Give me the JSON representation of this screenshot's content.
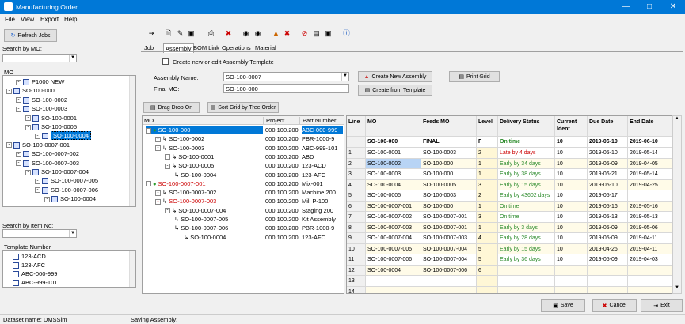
{
  "window": {
    "title": "Manufacturing Order"
  },
  "menu": [
    "File",
    "View",
    "Export",
    "Help"
  ],
  "left": {
    "refresh_label": "Refresh Jobs",
    "search_mo_label": "Search by MO:",
    "mo_header": "MO",
    "mo_tree": [
      {
        "label": "P1000 NEW",
        "depth": 1
      },
      {
        "label": "SO-100-000",
        "depth": 0
      },
      {
        "label": "SO-100-0002",
        "depth": 1
      },
      {
        "label": "SO-100-0003",
        "depth": 1
      },
      {
        "label": "SO-100-0001",
        "depth": 2
      },
      {
        "label": "SO-100-0005",
        "depth": 2
      },
      {
        "label": "SO-100-0004",
        "depth": 3,
        "selected": true
      },
      {
        "label": "SO-100-0007-001",
        "depth": 0
      },
      {
        "label": "SO-100-0007-002",
        "depth": 1
      },
      {
        "label": "SO-100-0007-003",
        "depth": 1
      },
      {
        "label": "SO-100-0007-004",
        "depth": 2
      },
      {
        "label": "SO-100-0007-005",
        "depth": 3
      },
      {
        "label": "SO-100-0007-006",
        "depth": 3
      },
      {
        "label": "SO-100-0004",
        "depth": 4
      }
    ],
    "search_item_label": "Search by Item No:",
    "template_header": "Template Number",
    "templates": [
      "123-ACD",
      "123-AFC",
      "ABC-000-999",
      "ABC-999-101"
    ]
  },
  "tabs": [
    "Job",
    "Assembly",
    "BOM Link",
    "Operations",
    "Material"
  ],
  "assembly": {
    "create_checkbox_label": "Create new or edit Assembly Template",
    "assembly_name_label": "Assembly Name:",
    "assembly_name_value": "SO-100-0007",
    "final_mo_label": "Final MO:",
    "final_mo_value": "SO-100-000",
    "create_new_label": "Create New Assembly",
    "create_template_label": "Create from Template",
    "print_grid_label": "Print Grid",
    "drag_drop_label": "Drag Drop On",
    "sort_grid_label": "Sort Grid by Tree Order"
  },
  "tree": {
    "headers": [
      "MO",
      "Project",
      "Part Number"
    ],
    "rows": [
      {
        "mo": "SO-100-000",
        "project": "000.100.200",
        "part": "ABC-000-999",
        "indent": 0,
        "color": "#cc0000",
        "selected": true
      },
      {
        "mo": "SO-100-0002",
        "project": "000.100.200",
        "part": "PBR-1000-9",
        "indent": 1,
        "color": "#000000"
      },
      {
        "mo": "SO-100-0003",
        "project": "000.100.200",
        "part": "ABC-999-101",
        "indent": 1,
        "color": "#000000"
      },
      {
        "mo": "SO-100-0001",
        "project": "000.100.200",
        "part": "ABD",
        "indent": 2,
        "color": "#000000"
      },
      {
        "mo": "SO-100-0005",
        "project": "000.100.200",
        "part": "123-ACD",
        "indent": 2,
        "color": "#000000"
      },
      {
        "mo": "SO-100-0004",
        "project": "000.100.200",
        "part": "123-AFC",
        "indent": 3,
        "color": "#000000"
      },
      {
        "mo": "SO-100-0007-001",
        "project": "000.100.200",
        "part": "Mix-001",
        "indent": 0,
        "color": "#cc0000"
      },
      {
        "mo": "SO-100-0007-002",
        "project": "000.100.200",
        "part": "Machine 200",
        "indent": 1,
        "color": "#000000"
      },
      {
        "mo": "SO-100-0007-003",
        "project": "000.100.200",
        "part": "Mill P-100",
        "indent": 1,
        "color": "#cc0000"
      },
      {
        "mo": "SO-100-0007-004",
        "project": "000.100.200",
        "part": "Staging 200",
        "indent": 2,
        "color": "#000000"
      },
      {
        "mo": "SO-100-0007-005",
        "project": "000.100.200",
        "part": "Kit Assembly",
        "indent": 3,
        "color": "#000000"
      },
      {
        "mo": "SO-100-0007-006",
        "project": "000.100.200",
        "part": "PBR-1000-9",
        "indent": 3,
        "color": "#000000"
      },
      {
        "mo": "SO-100-0004",
        "project": "000.100.200",
        "part": "123-AFC",
        "indent": 4,
        "color": "#000000"
      }
    ]
  },
  "grid": {
    "headers": [
      "Line",
      "MO",
      "Feeds MO",
      "Level",
      "Delivery Status",
      "Current Ident",
      "Due Date",
      "End Date"
    ],
    "summary": [
      "",
      "SO-100-000",
      "FINAL",
      "F",
      "On time",
      "10",
      "2019-06-10",
      "2019-06-10"
    ],
    "rows": [
      {
        "line": "1",
        "mo": "SO-100-0001",
        "feeds": "SO-100-0003",
        "level": "2",
        "status": "Late by 4 days",
        "status_color": "#cc0000",
        "ident": "10",
        "due": "2019-05-10",
        "end": "2019-05-14"
      },
      {
        "line": "2",
        "mo": "SO-100-0002",
        "feeds": "SO-100-000",
        "level": "1",
        "status": "Early by 34 days",
        "status_color": "#2a8a2a",
        "ident": "10",
        "due": "2019-05-09",
        "end": "2019-04-05"
      },
      {
        "line": "3",
        "mo": "SO-100-0003",
        "feeds": "SO-100-000",
        "level": "1",
        "status": "Early by 38 days",
        "status_color": "#2a8a2a",
        "ident": "10",
        "due": "2019-06-21",
        "end": "2019-05-14"
      },
      {
        "line": "4",
        "mo": "SO-100-0004",
        "feeds": "SO-100-0005",
        "level": "3",
        "status": "Early by 15 days",
        "status_color": "#2a8a2a",
        "ident": "10",
        "due": "2019-05-10",
        "end": "2019-04-25"
      },
      {
        "line": "5",
        "mo": "SO-100-0005",
        "feeds": "SO-100-0003",
        "level": "2",
        "status": "Early by 43602 days",
        "status_color": "#2a8a2a",
        "ident": "10",
        "due": "2019-05-17",
        "end": ""
      },
      {
        "line": "6",
        "mo": "SO-100-0007-001",
        "feeds": "SO-100-000",
        "level": "1",
        "status": "On time",
        "status_color": "#2a8a2a",
        "ident": "10",
        "due": "2019-05-16",
        "end": "2019-05-16"
      },
      {
        "line": "7",
        "mo": "SO-100-0007-002",
        "feeds": "SO-100-0007-001",
        "level": "3",
        "status": "On time",
        "status_color": "#2a8a2a",
        "ident": "10",
        "due": "2019-05-13",
        "end": "2019-05-13"
      },
      {
        "line": "8",
        "mo": "SO-100-0007-003",
        "feeds": "SO-100-0007-001",
        "level": "1",
        "status": "Early by 3 days",
        "status_color": "#2a8a2a",
        "ident": "10",
        "due": "2019-05-09",
        "end": "2019-05-06"
      },
      {
        "line": "9",
        "mo": "SO-100-0007-004",
        "feeds": "SO-100-0007-003",
        "level": "4",
        "status": "Early by 28 days",
        "status_color": "#2a8a2a",
        "ident": "10",
        "due": "2019-05-09",
        "end": "2019-04-11"
      },
      {
        "line": "10",
        "mo": "SO-100-0007-005",
        "feeds": "SO-100-0007-004",
        "level": "5",
        "status": "Early by 15 days",
        "status_color": "#2a8a2a",
        "ident": "10",
        "due": "2019-04-26",
        "end": "2019-04-11"
      },
      {
        "line": "11",
        "mo": "SO-100-0007-006",
        "feeds": "SO-100-0007-004",
        "level": "5",
        "status": "Early by 36 days",
        "status_color": "#2a8a2a",
        "ident": "10",
        "due": "2019-05-09",
        "end": "2019-04-03"
      },
      {
        "line": "12",
        "mo": "SO-100-0004",
        "feeds": "SO-100-0007-006",
        "level": "6",
        "status": "",
        "status_color": "#000000",
        "ident": "",
        "due": "",
        "end": ""
      },
      {
        "line": "13",
        "mo": "",
        "feeds": "",
        "level": "",
        "status": "",
        "status_color": "#000000",
        "ident": "",
        "due": "",
        "end": ""
      },
      {
        "line": "14",
        "mo": "",
        "feeds": "",
        "level": "",
        "status": "",
        "status_color": "#000000",
        "ident": "",
        "due": "",
        "end": ""
      }
    ]
  },
  "buttons": {
    "save": "Save",
    "cancel": "Cancel",
    "exit": "Exit"
  },
  "status": {
    "dataset": "Dataset name:  DMSSim",
    "saving": "Saving Assembly:"
  },
  "colors": {
    "titlebar": "#0078d7",
    "selection": "#0078d7",
    "level_col": "#fff7d6",
    "alt_row": "#fffbe8"
  }
}
